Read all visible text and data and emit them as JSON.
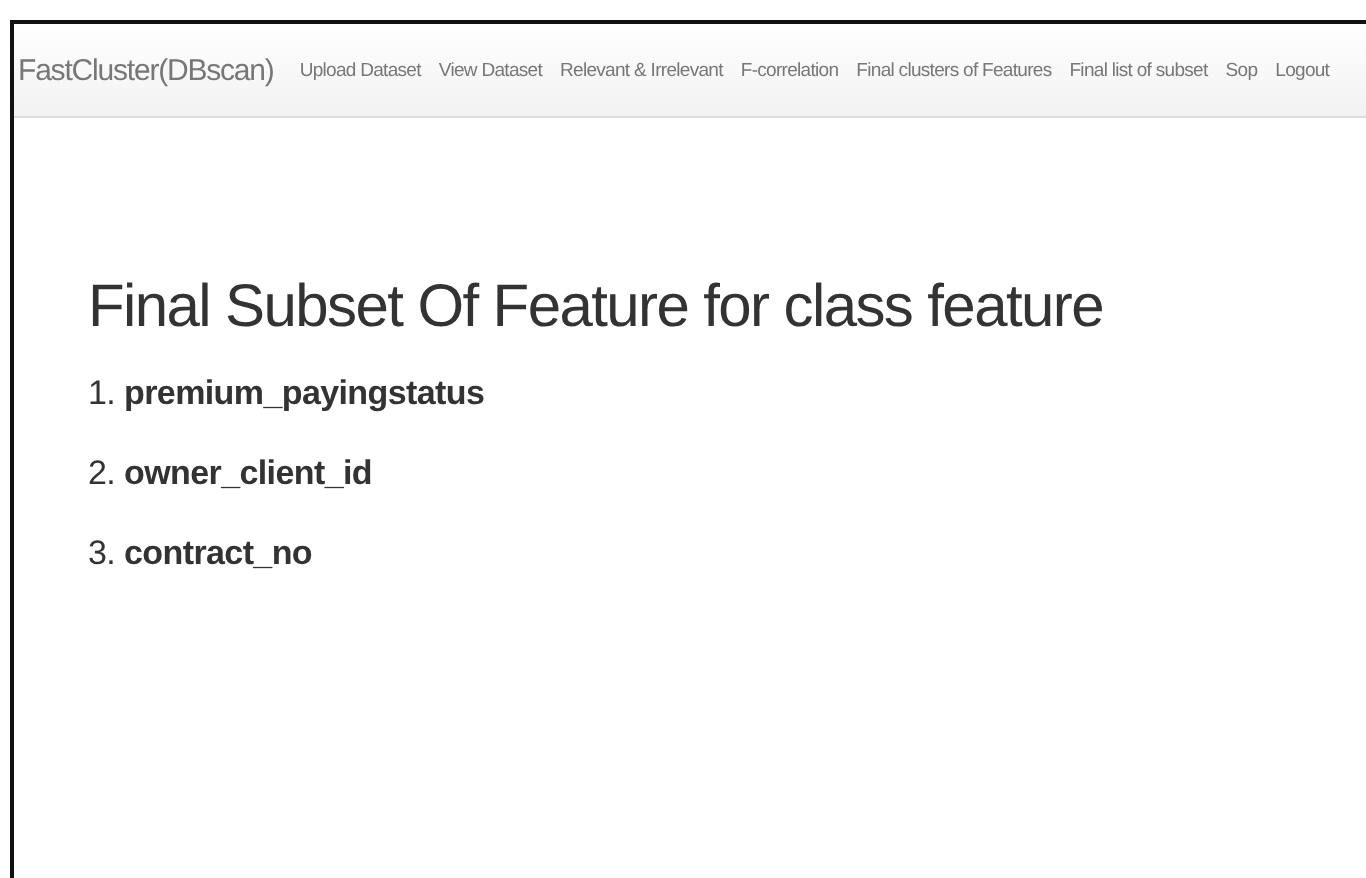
{
  "navbar": {
    "brand": "FastCluster(DBscan)",
    "links": [
      {
        "label": "Upload Dataset"
      },
      {
        "label": "View Dataset"
      },
      {
        "label": "Relevant & Irrelevant"
      },
      {
        "label": "F-correlation"
      },
      {
        "label": "Final clusters of Features"
      },
      {
        "label": "Final list of subset"
      },
      {
        "label": "Sop"
      },
      {
        "label": "Logout"
      }
    ]
  },
  "heading": "Final Subset Of Feature for class feature",
  "features": [
    {
      "text": "1. **premium_payingstatus**"
    },
    {
      "text": "2. **owner_client_id**"
    },
    {
      "text": "3. **contract_no**"
    }
  ]
}
